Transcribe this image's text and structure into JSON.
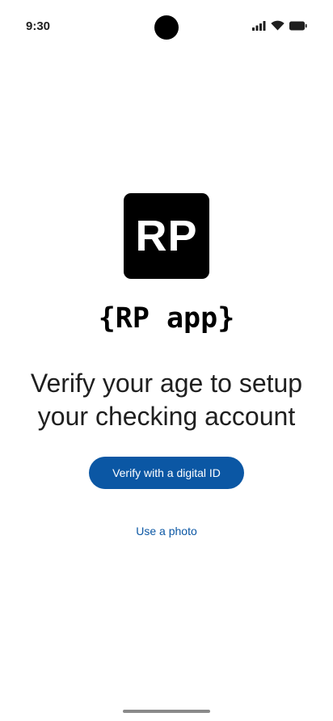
{
  "status_bar": {
    "time": "9:30",
    "icons": [
      "signal-icon",
      "wifi-icon",
      "battery-icon"
    ]
  },
  "logo": {
    "text": "RP"
  },
  "app": {
    "name": "{RP app}"
  },
  "headline": "Verify your age to setup your checking account",
  "actions": {
    "primary_label": "Verify with a digital ID",
    "secondary_label": "Use a photo"
  },
  "colors": {
    "primary": "#0b57a4",
    "logo_background": "#000000",
    "background": "#ffffff"
  }
}
